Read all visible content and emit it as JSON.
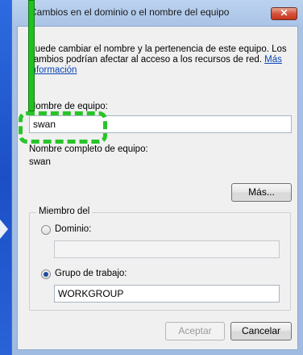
{
  "window": {
    "title": "Cambios en el dominio o el nombre del equipo",
    "close_label": "✕"
  },
  "content": {
    "description": "Puede cambiar el nombre y la pertenencia de este equipo. Los cambios podrían afectar al acceso a los recursos de red.",
    "more_info_link": "Más información",
    "computer_name_label": "Nombre de equipo:",
    "computer_name_value": "swan",
    "full_name_label": "Nombre completo de equipo:",
    "full_name_value": "swan",
    "more_button": "Más..."
  },
  "member_of": {
    "title": "Miembro del",
    "domain_label": "Dominio:",
    "domain_value": "",
    "domain_checked": false,
    "workgroup_label": "Grupo de trabajo:",
    "workgroup_value": "WORKGROUP",
    "workgroup_checked": true
  },
  "footer": {
    "ok_button": "Aceptar",
    "cancel_button": "Cancelar"
  },
  "colors": {
    "highlight": "#29c429",
    "link": "#0a45b8"
  }
}
